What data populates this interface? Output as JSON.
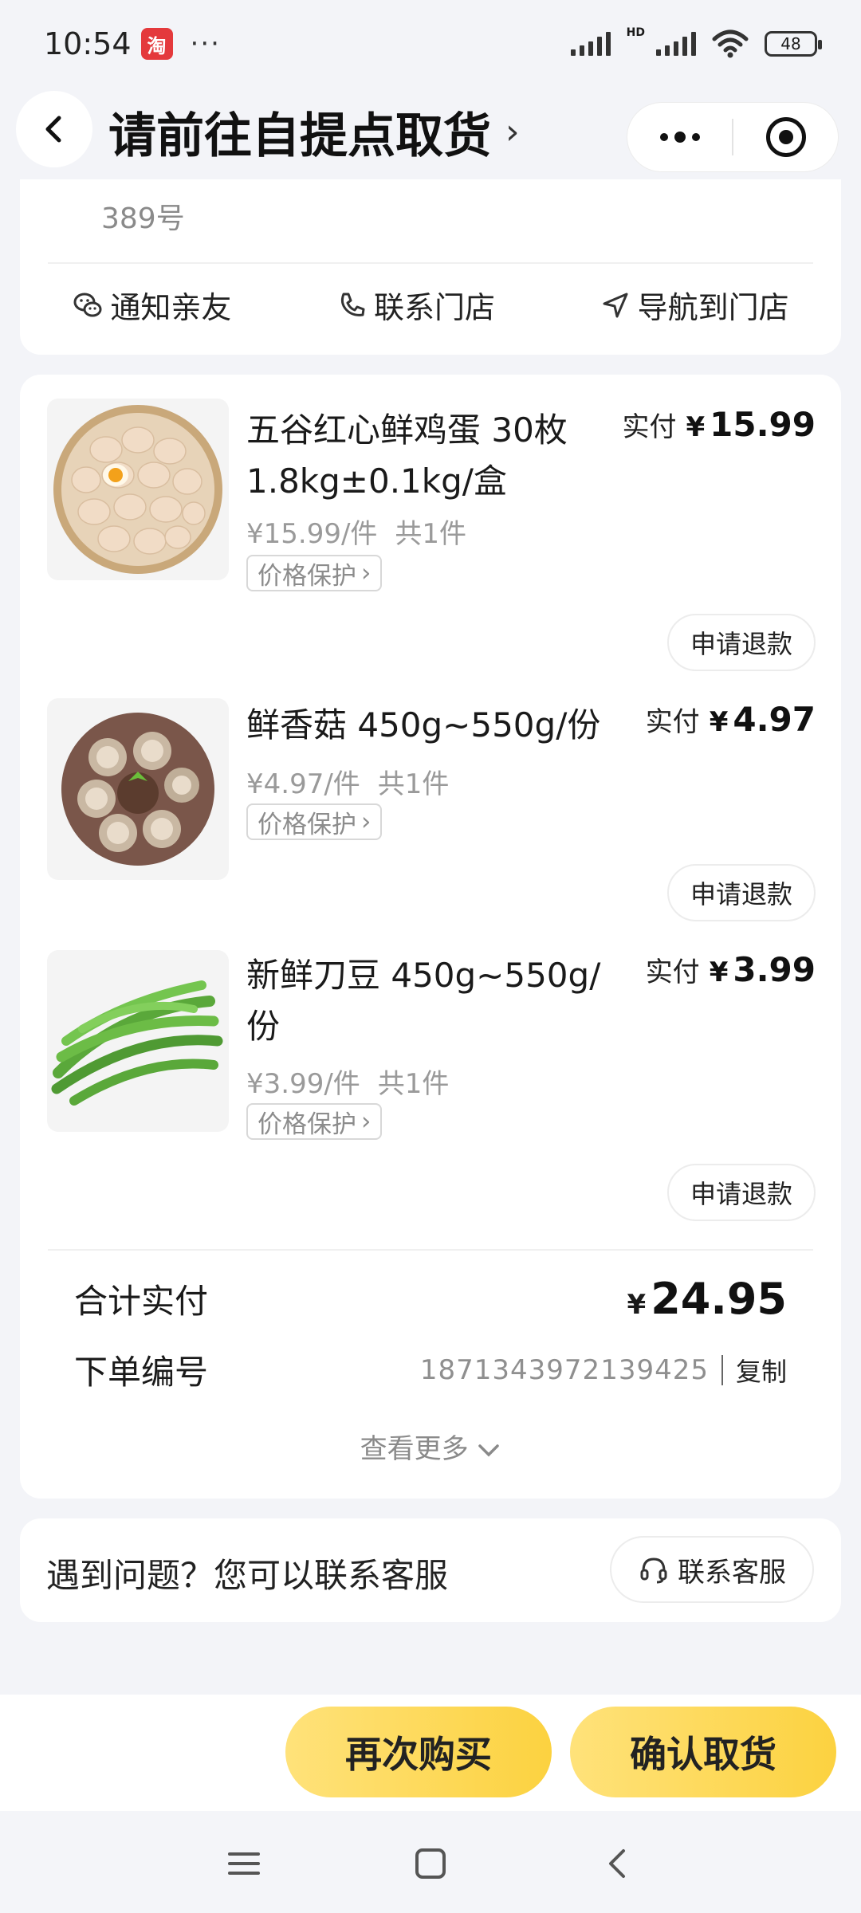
{
  "status_bar": {
    "time": "10:54",
    "app_badge": "淘",
    "dots": "···",
    "hd": "HD",
    "battery": "48"
  },
  "header": {
    "title": "请前往自提点取货",
    "title_chevron": "›"
  },
  "address": {
    "text_tail": "389号",
    "actions": [
      {
        "label": "通知亲友",
        "icon": "wechat-icon"
      },
      {
        "label": "联系门店",
        "icon": "phone-icon"
      },
      {
        "label": "导航到门店",
        "icon": "navigation-icon"
      }
    ]
  },
  "products": [
    {
      "name": "五谷红心鲜鸡蛋 30枚 1.8kg±0.1kg/盒",
      "paid_label": "实付",
      "currency": "¥",
      "paid": "15.99",
      "unit_price": "¥15.99/件",
      "qty": "共1件",
      "tag": "价格保护",
      "refund": "申请退款",
      "image": "eggs-image"
    },
    {
      "name": "鲜香菇 450g~550g/份",
      "paid_label": "实付",
      "currency": "¥",
      "paid": "4.97",
      "unit_price": "¥4.97/件",
      "qty": "共1件",
      "tag": "价格保护",
      "refund": "申请退款",
      "image": "shiitake-image"
    },
    {
      "name": "新鲜刀豆 450g~550g/份",
      "paid_label": "实付",
      "currency": "¥",
      "paid": "3.99",
      "unit_price": "¥3.99/件",
      "qty": "共1件",
      "tag": "价格保护",
      "refund": "申请退款",
      "image": "green-beans-image"
    }
  ],
  "summary": {
    "total_label": "合计实付",
    "currency": "¥",
    "total": "24.95",
    "order_label": "下单编号",
    "order_no": "1871343972139425",
    "copy": "复制",
    "view_more": "查看更多"
  },
  "help": {
    "text": "遇到问题？您可以联系客服",
    "button": "联系客服"
  },
  "actions": {
    "rebuy": "再次购买",
    "confirm": "确认取货"
  },
  "colors": {
    "accent_yellow": "#fcd240",
    "background": "#f3f4f8",
    "card": "#ffffff"
  }
}
